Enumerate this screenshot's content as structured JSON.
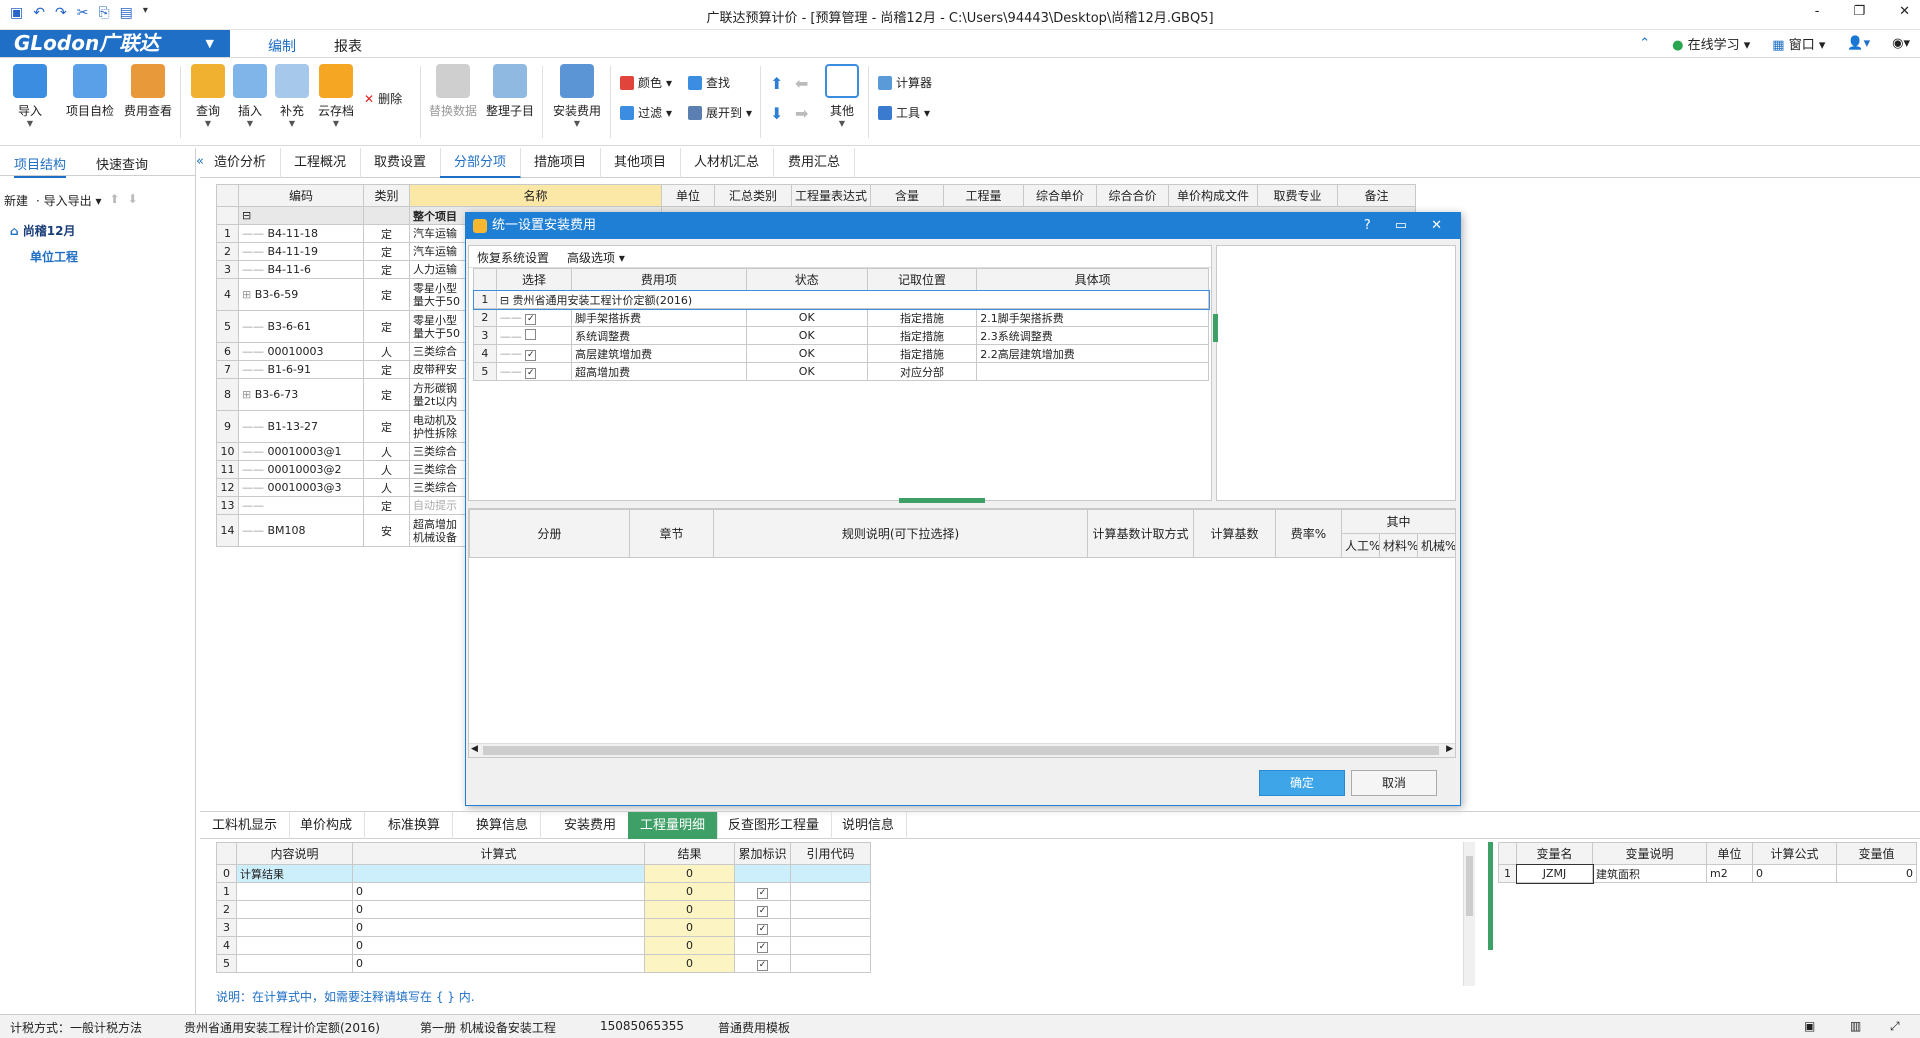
{
  "window": {
    "title": "广联达预算计价 - [预算管理 - 尚稽12月 - C:\\Users\\94443\\Desktop\\尚稽12月.GBQ5]",
    "min": "-",
    "restore": "❐",
    "close": "✕"
  },
  "menu": {
    "brand": "GLodon广联达",
    "tabs": [
      "编制",
      "报表"
    ],
    "right": [
      "在线学习",
      "窗口"
    ]
  },
  "ribbon": {
    "big": [
      {
        "label": "导入",
        "dd": "▼"
      },
      {
        "label": "项目自检"
      },
      {
        "label": "费用查看"
      },
      {
        "label": "查询",
        "dd": "▼"
      },
      {
        "label": "插入",
        "dd": "▼"
      },
      {
        "label": "补充",
        "dd": "▼"
      },
      {
        "label": "云存档",
        "dd": "▼"
      },
      {
        "label": "删除"
      },
      {
        "label": "替换数据"
      },
      {
        "label": "整理子目"
      },
      {
        "label": "安装费用",
        "dd": "▼"
      },
      {
        "label": "其他",
        "dd": "▼"
      }
    ],
    "small": {
      "color": "颜色",
      "find": "查找",
      "filter": "过滤",
      "expand": "展开到",
      "calc": "计算器",
      "tools": "工具"
    }
  },
  "left": {
    "tabs": [
      "项目结构",
      "快速查询"
    ],
    "tools": [
      "新建",
      "导入导出"
    ],
    "project": "尚稽12月",
    "unit": "单位工程"
  },
  "subtabs": [
    "造价分析",
    "工程概况",
    "取费设置",
    "分部分项",
    "措施项目",
    "其他项目",
    "人材机汇总",
    "费用汇总"
  ],
  "main_grid": {
    "headers": [
      "编码",
      "类别",
      "名称",
      "单位",
      "汇总类别",
      "工程量表达式",
      "含量",
      "工程量",
      "综合单价",
      "综合合价",
      "单价构成文件",
      "取费专业",
      "备注"
    ],
    "top": [
      "",
      "",
      "整个项目"
    ],
    "rows": [
      [
        "1",
        "B4-11-18",
        "定",
        "汽车运输"
      ],
      [
        "2",
        "B4-11-19",
        "定",
        "汽车运输"
      ],
      [
        "3",
        "B4-11-6",
        "定",
        "人力运输"
      ],
      [
        "4",
        "B3-6-59",
        "定",
        "零星小型\n量大于50"
      ],
      [
        "5",
        "B3-6-61",
        "定",
        "零星小型\n量大于50"
      ],
      [
        "6",
        "00010003",
        "人",
        "三类综合"
      ],
      [
        "7",
        "B1-6-91",
        "定",
        "皮带秤安"
      ],
      [
        "8",
        "B3-6-73",
        "定",
        "方形碳钢\n量2t以内"
      ],
      [
        "9",
        "B1-13-27",
        "定",
        "电动机及\n护性拆除"
      ],
      [
        "10",
        "00010003@1",
        "人",
        "三类综合"
      ],
      [
        "11",
        "00010003@2",
        "人",
        "三类综合"
      ],
      [
        "12",
        "00010003@3",
        "人",
        "三类综合"
      ],
      [
        "13",
        "",
        "定",
        "自动提示"
      ],
      [
        "14",
        "BM108",
        "安",
        "超高增加\n机械设备"
      ]
    ]
  },
  "dialog": {
    "title": "统一设置安装费用",
    "toolbar": [
      "恢复系统设置",
      "高级选项"
    ],
    "headers": [
      "选择",
      "费用项",
      "状态",
      "记取位置",
      "具体项"
    ],
    "group": {
      "num": "1",
      "label": "贵州省通用安装工程计价定额(2016)"
    },
    "rows": [
      {
        "num": "2",
        "checked": "✓",
        "name": "脚手架搭拆费",
        "status": "OK",
        "pos": "指定措施",
        "item": "2.1脚手架搭拆费"
      },
      {
        "num": "3",
        "checked": "",
        "name": "系统调整费",
        "status": "OK",
        "pos": "指定措施",
        "item": "2.3系统调整费"
      },
      {
        "num": "4",
        "checked": "✓",
        "name": "高层建筑增加费",
        "status": "OK",
        "pos": "指定措施",
        "item": "2.2高层建筑增加费"
      },
      {
        "num": "5",
        "checked": "✓",
        "name": "超高增加费",
        "status": "OK",
        "pos": "对应分部",
        "item": ""
      }
    ],
    "lower_headers": [
      "分册",
      "章节",
      "规则说明(可下拉选择)",
      "计算基数计取方式",
      "计算基数",
      "费率%",
      "其中"
    ],
    "sub_headers": [
      "人工%",
      "材料%",
      "机械%"
    ],
    "ok": "确定",
    "cancel": "取消"
  },
  "bottom_tabs": [
    "工料机显示",
    "单价构成",
    "标准换算",
    "换算信息",
    "安装费用",
    "工程量明细",
    "反查图形工程量",
    "说明信息"
  ],
  "qty_grid": {
    "headers": [
      "内容说明",
      "计算式",
      "结果",
      "累加标识",
      "引用代码"
    ],
    "rows": [
      [
        "0",
        "计算结果",
        "",
        "0"
      ],
      [
        "1",
        "",
        "0",
        "0"
      ],
      [
        "2",
        "",
        "0",
        "0"
      ],
      [
        "3",
        "",
        "0",
        "0"
      ],
      [
        "4",
        "",
        "0",
        "0"
      ],
      [
        "5",
        "",
        "0",
        "0"
      ]
    ],
    "note": "说明：在计算式中，如需要注释请填写在 { } 内."
  },
  "var_grid": {
    "headers": [
      "变量名",
      "变量说明",
      "单位",
      "计算公式",
      "变量值"
    ],
    "row": [
      "1",
      "JZMJ",
      "建筑面积",
      "m2",
      "0",
      "0"
    ]
  },
  "status": [
    "计税方式：一般计税方法",
    "贵州省通用安装工程计价定额(2016)",
    "第一册 机械设备安装工程",
    "15085065355",
    "普通费用模板"
  ]
}
